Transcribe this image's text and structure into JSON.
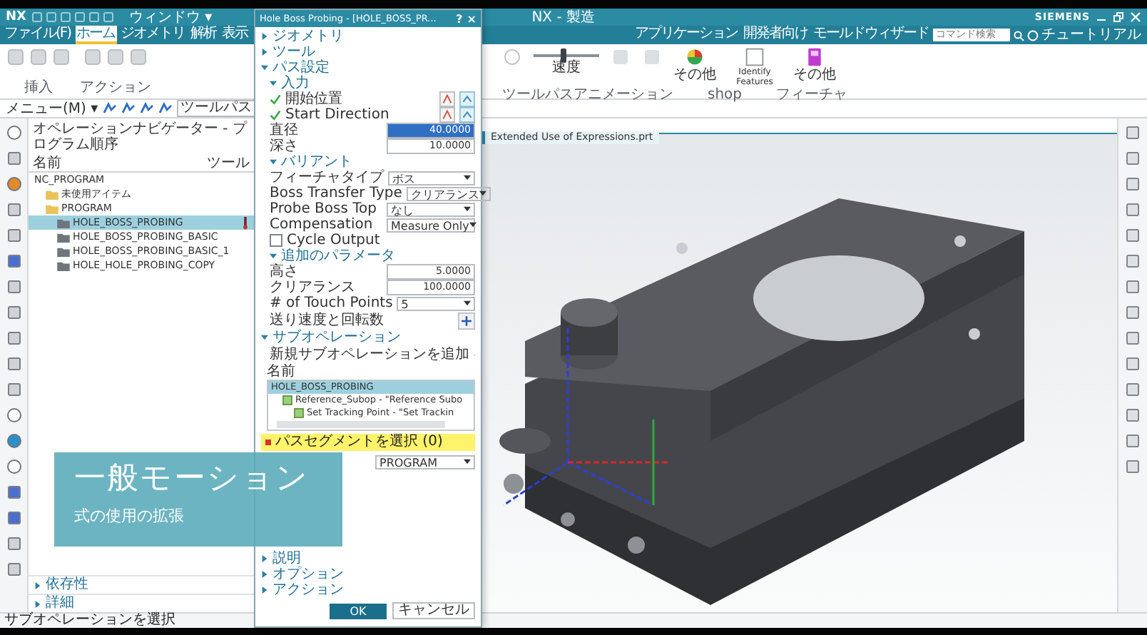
{
  "title_bar": {
    "logo": "NX",
    "window_menu": "ウィンドウ ▾",
    "title": "NX - 製造",
    "brand": "SIEMENS"
  },
  "menu_tabs": [
    {
      "label": "ファイル(F)",
      "selected": false
    },
    {
      "label": "ホーム",
      "selected": true
    },
    {
      "label": "ジオメトリ",
      "selected": false
    },
    {
      "label": "解析",
      "selected": false
    },
    {
      "label": "表示",
      "selected": false
    }
  ],
  "menu_tabs_right": [
    {
      "label": "アプリケーション",
      "selected": false
    },
    {
      "label": "開発者向け",
      "selected": false
    },
    {
      "label": "モールドウィザード",
      "selected": false
    }
  ],
  "search": {
    "placeholder": "コマンド検索"
  },
  "tutorial": "チュートリアル",
  "ribbon_left": {
    "groups": [
      "挿入",
      "アクション"
    ]
  },
  "ribbon_right": {
    "speed": {
      "label": "速度",
      "level": 0.45
    },
    "items": [
      {
        "label": "その他",
        "kind": "palette"
      },
      {
        "label": "Identify Features",
        "kind": "frame"
      },
      {
        "label": "その他",
        "kind": "book"
      }
    ],
    "groups": [
      "ツールパスアニメーション",
      "shop",
      "フィーチャ"
    ]
  },
  "toolbar": {
    "menu": "メニュー(M) ▾",
    "filter": "ツールパス"
  },
  "navigator": {
    "title": "オペレーションナビゲーター - プログラム順序",
    "columns": [
      "名前",
      "ツール"
    ],
    "tree": [
      {
        "label": "NC_PROGRAM",
        "selected": false,
        "children": [
          {
            "label": "未使用アイテム",
            "selected": false
          },
          {
            "label": "PROGRAM",
            "selected": false,
            "children": [
              {
                "label": "HOLE_BOSS_PROBING",
                "selected": true
              },
              {
                "label": "HOLE_BOSS_PROBING_BASIC",
                "selected": false
              },
              {
                "label": "HOLE_BOSS_PROBING_BASIC_1",
                "selected": false
              },
              {
                "label": "HOLE_HOLE_PROBING_COPY",
                "selected": false
              }
            ]
          }
        ]
      }
    ],
    "sections": [
      {
        "label": "依存性",
        "expanded": false
      },
      {
        "label": "詳細",
        "expanded": false
      }
    ]
  },
  "dialog": {
    "title": "Hole Boss Probing - [HOLE_BOSS_PR...",
    "help": "?",
    "close": "×",
    "rows": [
      {
        "kind": "section",
        "label": "ジオメトリ",
        "expanded": false
      },
      {
        "kind": "section",
        "label": "ツール",
        "expanded": false
      },
      {
        "kind": "section",
        "label": "パス設定",
        "expanded": true
      },
      {
        "kind": "subsection",
        "label": "入力",
        "expanded": true
      },
      {
        "kind": "point",
        "label": "開始位置",
        "checked": true
      },
      {
        "kind": "point",
        "label": "Start Direction",
        "checked": true
      },
      {
        "kind": "number",
        "label": "直径",
        "value": "40.0000",
        "selected": true
      },
      {
        "kind": "number",
        "label": "深さ",
        "value": "10.0000",
        "selected": false
      },
      {
        "kind": "subsection",
        "label": "バリアント",
        "expanded": true
      },
      {
        "kind": "select",
        "label": "フィーチャタイプ",
        "value": "ボス"
      },
      {
        "kind": "select",
        "label": "Boss Transfer Type",
        "value": "クリアランス"
      },
      {
        "kind": "select",
        "label": "Probe Boss Top",
        "value": "なし"
      },
      {
        "kind": "select",
        "label": "Compensation",
        "value": "Measure Only"
      },
      {
        "kind": "checkbox",
        "label": "Cycle Output",
        "checked": false
      },
      {
        "kind": "subsection",
        "label": "追加のパラメータ",
        "expanded": true
      },
      {
        "kind": "number",
        "label": "高さ",
        "value": "5.0000",
        "selected": false
      },
      {
        "kind": "number",
        "label": "クリアランス",
        "value": "100.0000",
        "selected": false
      },
      {
        "kind": "select",
        "label": "# of Touch Points",
        "value": "5"
      },
      {
        "kind": "action",
        "label": "送り速度と回転数"
      },
      {
        "kind": "section",
        "label": "サブオペレーション",
        "expanded": true
      },
      {
        "kind": "action",
        "label": "新規サブオペレーションを追加"
      },
      {
        "kind": "list",
        "header": "名前",
        "items": [
          {
            "label": "HOLE_BOSS_PROBING",
            "selected": true,
            "children": [
              {
                "label": "Reference_Subop - \"Reference Subo",
                "checked": true,
                "selected": false,
                "children": [
                  {
                    "label": "Set Tracking Point - \"Set Trackin",
                    "checked": true,
                    "selected": false
                  }
                ]
              }
            ]
          }
        ]
      },
      {
        "kind": "alert",
        "label": "パスセグメントを選択 (0)"
      },
      {
        "kind": "dropdown",
        "value": "PROGRAM"
      },
      {
        "kind": "section",
        "label": "説明",
        "expanded": false
      },
      {
        "kind": "section",
        "label": "オプション",
        "expanded": false
      },
      {
        "kind": "section",
        "label": "アクション",
        "expanded": false
      }
    ],
    "buttons": [
      "OK",
      "キャンセル"
    ]
  },
  "graphics": {
    "tab": "Extended Use of Expressions.prt"
  },
  "overlay": {
    "title": "一般モーション",
    "subtitle": "式の使用の拡張"
  },
  "status_bar": "サブオペレーションを選択"
}
